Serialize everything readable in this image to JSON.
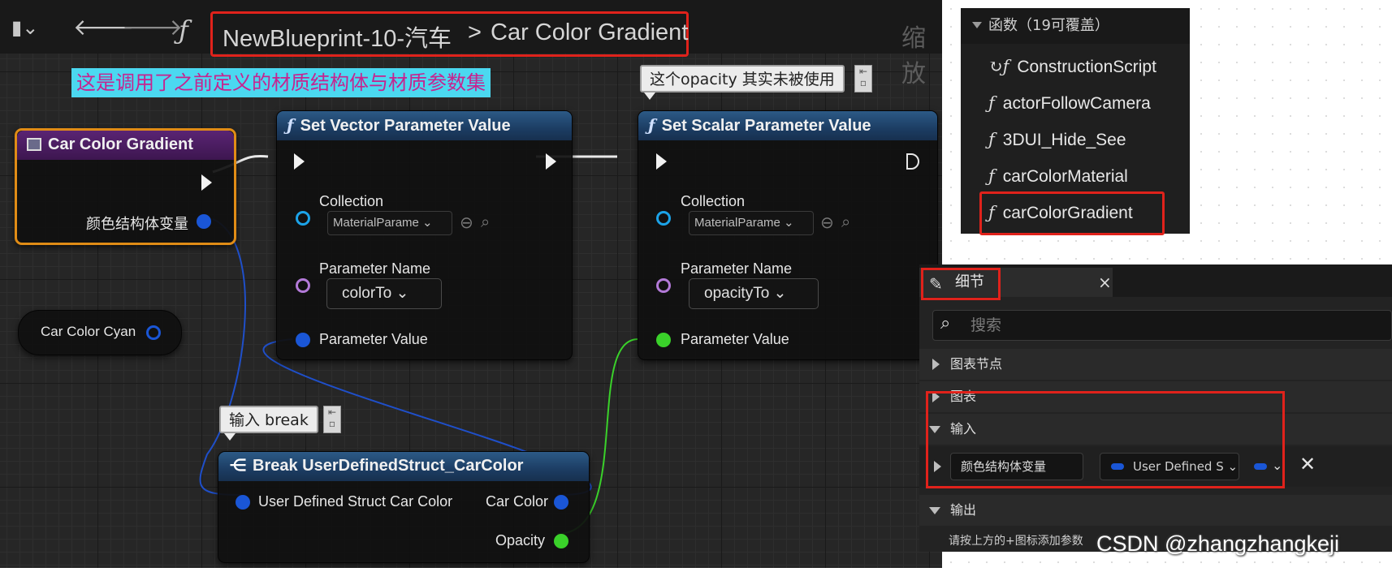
{
  "toolbar": {
    "bookmark_icon": "bookmark-dropdown-icon",
    "back_icon": "arrow-left-icon",
    "forward_icon": "arrow-right-icon",
    "function_icon": "ƒ",
    "breadcrumb_root": "NewBlueprint-10-汽车",
    "breadcrumb_sep": ">",
    "breadcrumb_current": "Car Color Gradient",
    "zoom_label": "缩放"
  },
  "comments": {
    "top_note": "这是调用了之前定义的材质结构体与材质参数集",
    "opacity_note": "这个opacity 其实未被使用",
    "break_note": "输入 break"
  },
  "nodes": {
    "entry": {
      "title": "Car Color Gradient",
      "input_pin": "颜色结构体变量"
    },
    "variable": {
      "label": "Car Color Cyan"
    },
    "set_vector": {
      "title": "Set Vector Parameter Value",
      "collection_label": "Collection",
      "collection_value": "MaterialParame",
      "param_name_label": "Parameter Name",
      "param_name_value": "colorTo",
      "param_value_label": "Parameter Value"
    },
    "set_scalar": {
      "title": "Set Scalar Parameter Value",
      "collection_label": "Collection",
      "collection_value": "MaterialParame",
      "param_name_label": "Parameter Name",
      "param_name_value": "opacityTo",
      "param_value_label": "Parameter Value"
    },
    "break_struct": {
      "title": "Break UserDefinedStruct_CarColor",
      "input_label": "User Defined Struct Car Color",
      "out_color": "Car Color",
      "out_opacity": "Opacity"
    }
  },
  "functions_panel": {
    "header": "函数（19可覆盖）",
    "items": [
      "ConstructionScript",
      "actorFollowCamera",
      "3DUI_Hide_See",
      "carColorMaterial",
      "carColorGradient"
    ]
  },
  "details_panel": {
    "tab_title": "细节",
    "close": "×",
    "search_placeholder": "搜索",
    "categories": {
      "graph_node": "图表节点",
      "graph": "图表",
      "inputs": "输入",
      "outputs": "输出"
    },
    "input_param_name": "颜色结构体变量",
    "input_param_type": "User Defined S",
    "remove": "✕",
    "outputs_hint": "请按上方的+图标添加参数"
  },
  "watermark": "CSDN @zhangzhangkeji",
  "colors": {
    "highlight": "#e0221b",
    "struct_pin": "#1a56d6",
    "float_pin": "#3ad12a",
    "name_pin": "#b37ad8",
    "collection_pin": "#1ca3e8",
    "entry_border": "#e08c16"
  }
}
